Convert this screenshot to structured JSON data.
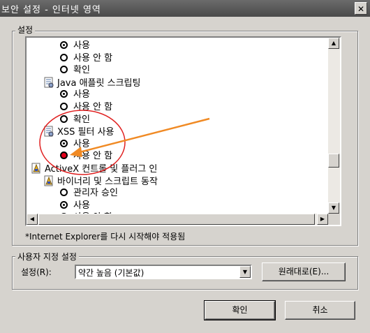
{
  "window": {
    "title": "보안 설정 - 인터넷 영역",
    "close_label": "✕"
  },
  "settings_group": {
    "label": "설정"
  },
  "tree": [
    {
      "type": "radio",
      "label": "사용",
      "checked": true
    },
    {
      "type": "radio",
      "label": "사용 안 함",
      "checked": false
    },
    {
      "type": "radio",
      "label": "확인",
      "checked": false
    },
    {
      "type": "category",
      "label": "Java 애플릿 스크립팅",
      "icon": "script-settings-icon"
    },
    {
      "type": "radio",
      "label": "사용",
      "checked": true
    },
    {
      "type": "radio",
      "label": "사용 안 함",
      "checked": false
    },
    {
      "type": "radio",
      "label": "확인",
      "checked": false
    },
    {
      "type": "category",
      "label": "XSS 필터 사용",
      "icon": "script-settings-icon"
    },
    {
      "type": "radio",
      "label": "사용",
      "checked": true
    },
    {
      "type": "radio",
      "label": "사용 안 함",
      "checked": false,
      "highlighted": true
    },
    {
      "type": "category-top",
      "label": "ActiveX 컨트롤 및 플러그 인",
      "icon": "activex-document-icon"
    },
    {
      "type": "category",
      "label": "바이너리 및 스크립트 동작",
      "icon": "activex-document-icon"
    },
    {
      "type": "radio",
      "label": "관리자 승인",
      "checked": false
    },
    {
      "type": "radio",
      "label": "사용",
      "checked": true
    },
    {
      "type": "radio",
      "label": "사용 안 함",
      "checked": false
    }
  ],
  "restart_note": "*Internet Explorer를 다시 시작해야 적용됨",
  "custom_group": {
    "label": "사용자 지정 설정",
    "reset_label": "설정(R):",
    "select_value": "약간 높음 (기본값)",
    "reset_button": "원래대로(E)..."
  },
  "footer": {
    "ok": "확인",
    "cancel": "취소"
  },
  "annotation_colors": {
    "circle": "#e02020",
    "arrow": "#f08a24"
  }
}
